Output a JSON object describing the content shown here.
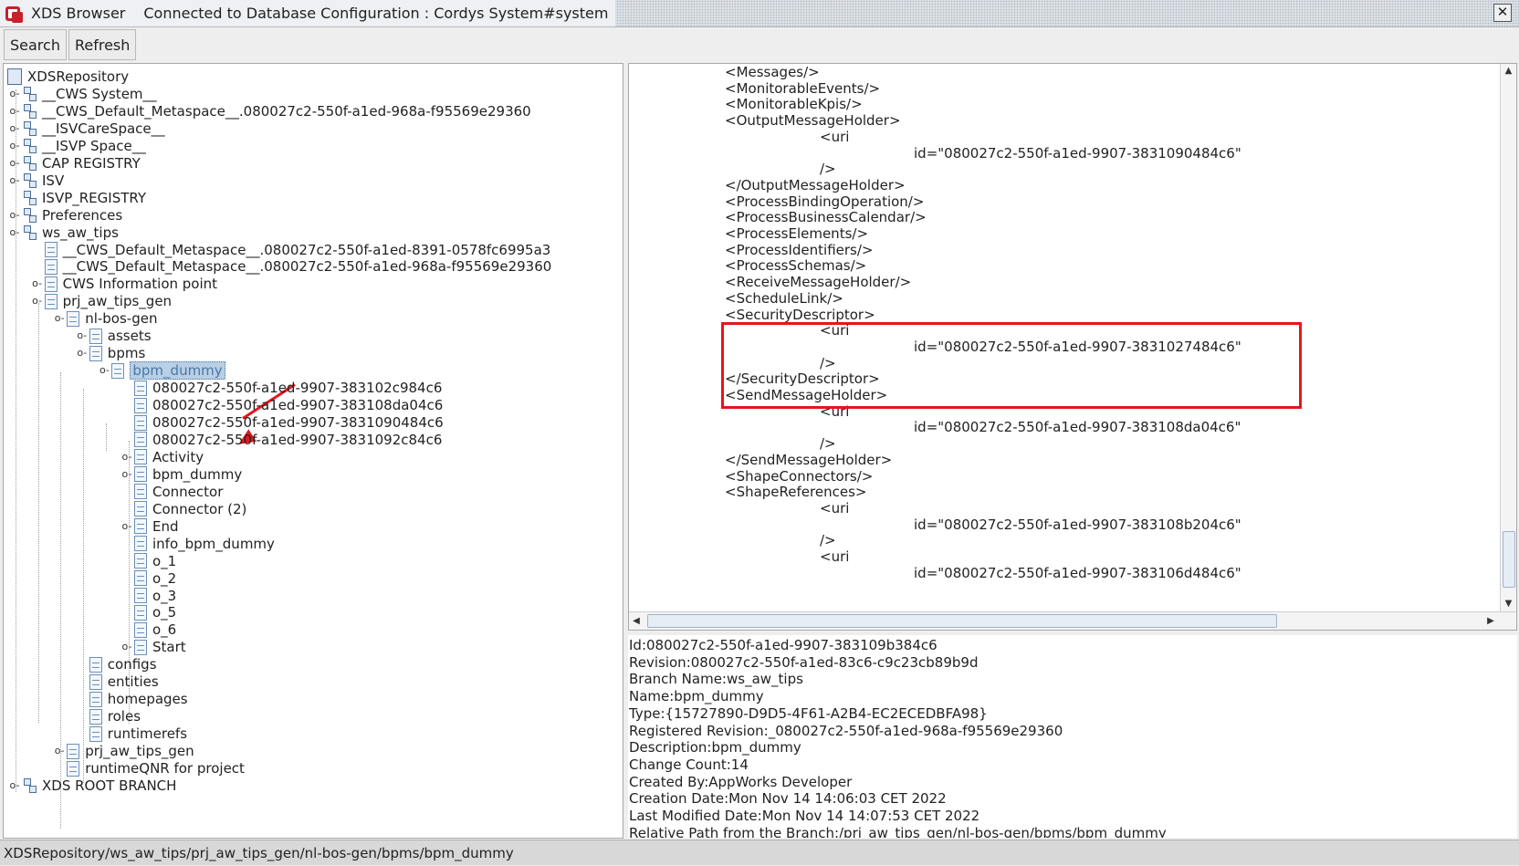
{
  "window": {
    "app_name": "XDS Browser",
    "title": "Connected to Database Configuration : Cordys System#system",
    "close_glyph": "✕"
  },
  "toolbar": {
    "search_label": "Search",
    "refresh_label": "Refresh"
  },
  "tree": {
    "nodes": [
      {
        "label": "XDSRepository",
        "icon": "repository-icon",
        "toggle": ""
      },
      {
        "label": "__CWS System__",
        "icon": "branch-icon",
        "toggle": "o-"
      },
      {
        "label": "__CWS_Default_Metaspace__.080027c2-550f-a1ed-968a-f95569e29360",
        "icon": "branch-icon",
        "toggle": "o-"
      },
      {
        "label": "__ISVCareSpace__",
        "icon": "branch-icon",
        "toggle": "o-"
      },
      {
        "label": "__ISVP Space__",
        "icon": "branch-icon",
        "toggle": "o-"
      },
      {
        "label": "CAP REGISTRY",
        "icon": "branch-icon",
        "toggle": "o-"
      },
      {
        "label": "ISV",
        "icon": "branch-icon",
        "toggle": "o-"
      },
      {
        "label": "ISVP_REGISTRY",
        "icon": "branch-icon",
        "toggle": ""
      },
      {
        "label": "Preferences",
        "icon": "branch-icon",
        "toggle": "o-"
      },
      {
        "label": "ws_aw_tips",
        "icon": "branch-icon",
        "toggle": "o-"
      },
      {
        "label": "__CWS_Default_Metaspace__.080027c2-550f-a1ed-8391-0578fc6995a3",
        "icon": "document-icon",
        "toggle": ""
      },
      {
        "label": "__CWS_Default_Metaspace__.080027c2-550f-a1ed-968a-f95569e29360",
        "icon": "document-icon",
        "toggle": ""
      },
      {
        "label": "CWS Information point",
        "icon": "document-icon",
        "toggle": "o-"
      },
      {
        "label": "prj_aw_tips_gen",
        "icon": "document-icon",
        "toggle": "o-"
      },
      {
        "label": "nl-bos-gen",
        "icon": "document-icon",
        "toggle": "o-"
      },
      {
        "label": "assets",
        "icon": "document-icon",
        "toggle": "o-"
      },
      {
        "label": "bpms",
        "icon": "document-icon",
        "toggle": "o-"
      },
      {
        "label": "bpm_dummy",
        "icon": "document-icon",
        "toggle": "o-",
        "selected": true
      },
      {
        "label": "080027c2-550f-a1ed-9907-383102c984c6",
        "icon": "document-icon",
        "toggle": ""
      },
      {
        "label": "080027c2-550f-a1ed-9907-383108da04c6",
        "icon": "document-icon",
        "toggle": ""
      },
      {
        "label": "080027c2-550f-a1ed-9907-3831090484c6",
        "icon": "document-icon",
        "toggle": ""
      },
      {
        "label": "080027c2-550f-a1ed-9907-3831092c84c6",
        "icon": "document-icon",
        "toggle": ""
      },
      {
        "label": "Activity",
        "icon": "document-icon",
        "toggle": "o-"
      },
      {
        "label": "bpm_dummy",
        "icon": "document-icon",
        "toggle": "o-"
      },
      {
        "label": "Connector",
        "icon": "document-icon",
        "toggle": ""
      },
      {
        "label": "Connector (2)",
        "icon": "document-icon",
        "toggle": ""
      },
      {
        "label": "End",
        "icon": "document-icon",
        "toggle": "o-"
      },
      {
        "label": "info_bpm_dummy",
        "icon": "document-icon",
        "toggle": ""
      },
      {
        "label": "o_1",
        "icon": "document-icon",
        "toggle": ""
      },
      {
        "label": "o_2",
        "icon": "document-icon",
        "toggle": ""
      },
      {
        "label": "o_3",
        "icon": "document-icon",
        "toggle": ""
      },
      {
        "label": "o_5",
        "icon": "document-icon",
        "toggle": ""
      },
      {
        "label": "o_6",
        "icon": "document-icon",
        "toggle": ""
      },
      {
        "label": "Start",
        "icon": "document-icon",
        "toggle": "o-"
      },
      {
        "label": "configs",
        "icon": "document-icon",
        "toggle": ""
      },
      {
        "label": "entities",
        "icon": "document-icon",
        "toggle": ""
      },
      {
        "label": "homepages",
        "icon": "document-icon",
        "toggle": ""
      },
      {
        "label": "roles",
        "icon": "document-icon",
        "toggle": ""
      },
      {
        "label": "runtimerefs",
        "icon": "document-icon",
        "toggle": ""
      },
      {
        "label": "prj_aw_tips_gen",
        "icon": "document-icon",
        "toggle": "o-"
      },
      {
        "label": "runtimeQNR for project",
        "icon": "document-icon",
        "toggle": ""
      },
      {
        "label": "XDS ROOT BRANCH",
        "icon": "branch-icon",
        "toggle": "o-"
      }
    ]
  },
  "xml": {
    "lines": [
      "<Messages/>",
      "<MonitorableEvents/>",
      "<MonitorableKpis/>",
      "<OutputMessageHolder>",
      "<uri",
      "id=\"080027c2-550f-a1ed-9907-3831090484c6\"",
      "/>",
      "</OutputMessageHolder>",
      "<ProcessBindingOperation/>",
      "<ProcessBusinessCalendar/>",
      "<ProcessElements/>",
      "<ProcessIdentifiers/>",
      "<ProcessSchemas/>",
      "<ReceiveMessageHolder/>",
      "<ScheduleLink/>",
      "<SecurityDescriptor>",
      "<uri",
      "id=\"080027c2-550f-a1ed-9907-3831027484c6\"",
      "/>",
      "</SecurityDescriptor>",
      "<SendMessageHolder>",
      "<uri",
      "id=\"080027c2-550f-a1ed-9907-383108da04c6\"",
      "/>",
      "</SendMessageHolder>",
      "<ShapeConnectors/>",
      "<ShapeReferences>",
      "<uri",
      "id=\"080027c2-550f-a1ed-9907-383108b204c6\"",
      "/>",
      "<uri",
      "id=\"080027c2-550f-a1ed-9907-383106d484c6\""
    ]
  },
  "info": {
    "lines": [
      "Id:080027c2-550f-a1ed-9907-383109b384c6",
      "Revision:080027c2-550f-a1ed-83c6-c9c23cb89b9d",
      "Branch Name:ws_aw_tips",
      "Name:bpm_dummy",
      "Type:{15727890-D9D5-4F61-A2B4-EC2ECEDBFA98}",
      "Registered Revision:_080027c2-550f-a1ed-968a-f95569e29360",
      "Description:bpm_dummy",
      "Change Count:14",
      "Created By:AppWorks Developer",
      "Creation Date:Mon Nov 14 14:06:03 CET 2022",
      "Last Modified Date:Mon Nov 14 14:07:53 CET 2022",
      "Relative Path from the Branch:/prj_aw_tips_gen/nl-bos-gen/bpms/bpm_dummy"
    ]
  },
  "status": {
    "path": "XDSRepository/ws_aw_tips/prj_aw_tips_gen/nl-bos-gen/bpms/bpm_dummy"
  },
  "colors": {
    "annotation_red": "#e8141c",
    "selection_bg": "#b8cfe5"
  }
}
